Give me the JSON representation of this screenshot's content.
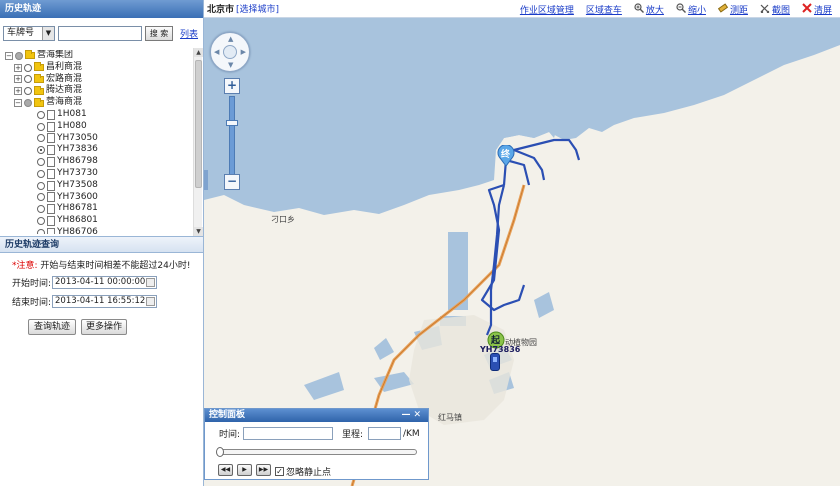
{
  "left_panel": {
    "title": "历史轨迹",
    "search": {
      "type_label": "车牌号",
      "value": "",
      "search_label": "搜 索",
      "list_link": "列表"
    },
    "tree": [
      {
        "label": "营海集团",
        "level": 0,
        "kind": "group"
      },
      {
        "label": "昌利商混",
        "level": 1,
        "kind": "folder"
      },
      {
        "label": "宏路商混",
        "level": 1,
        "kind": "folder"
      },
      {
        "label": "腾达商混",
        "level": 1,
        "kind": "folder"
      },
      {
        "label": "营海商混",
        "level": 1,
        "kind": "folder-open"
      },
      {
        "label": "1H081",
        "level": 2,
        "kind": "vehicle",
        "selected": false
      },
      {
        "label": "1H080",
        "level": 2,
        "kind": "vehicle",
        "selected": false
      },
      {
        "label": "YH73050",
        "level": 2,
        "kind": "vehicle",
        "selected": false
      },
      {
        "label": "YH73836",
        "level": 2,
        "kind": "vehicle",
        "selected": true
      },
      {
        "label": "YH86798",
        "level": 2,
        "kind": "vehicle",
        "selected": false
      },
      {
        "label": "YH73730",
        "level": 2,
        "kind": "vehicle",
        "selected": false
      },
      {
        "label": "YH73508",
        "level": 2,
        "kind": "vehicle",
        "selected": false
      },
      {
        "label": "YH73600",
        "level": 2,
        "kind": "vehicle",
        "selected": false
      },
      {
        "label": "YH86781",
        "level": 2,
        "kind": "vehicle",
        "selected": false
      },
      {
        "label": "YH86801",
        "level": 2,
        "kind": "vehicle",
        "selected": false
      },
      {
        "label": "YH86706",
        "level": 2,
        "kind": "vehicle",
        "selected": false
      }
    ],
    "query": {
      "title": "历史轨迹查询",
      "note_star": "*注意:",
      "note_text": "开始与结束时间相差不能超过24小时!",
      "start_label": "开始时间:",
      "start_value": "2013-04-11 00:00:00",
      "end_label": "结束时间:",
      "end_value": "2013-04-11 16:55:12",
      "query_btn": "查询轨迹",
      "more_btn": "更多操作"
    }
  },
  "map": {
    "city": "北京市",
    "select_city": "[选择城市]",
    "tools": [
      {
        "label": "作业区域管理",
        "icon": ""
      },
      {
        "label": "区域查车",
        "icon": ""
      },
      {
        "label": "放大",
        "icon": "zoom-in-icon"
      },
      {
        "label": "缩小",
        "icon": "zoom-out-icon"
      },
      {
        "label": "测距",
        "icon": "ruler-icon"
      },
      {
        "label": "截图",
        "icon": "screenshot-icon"
      },
      {
        "label": "清屏",
        "icon": "clear-icon"
      }
    ],
    "labels": {
      "place1": "刁口乡",
      "place2": "动植物园",
      "place3": "红马镇"
    },
    "markers": {
      "end": "终",
      "start": "起",
      "vehicle": "YH73836"
    },
    "route_color": "#2b4fb3"
  },
  "control_panel": {
    "title": "控制面板",
    "time_label": "时间:",
    "time_value": "",
    "mileage_label": "里程:",
    "mileage_value": "",
    "mileage_unit": "/KM",
    "progress": 0.0,
    "ignore_stop_label": "忽略静止点",
    "ignore_stop_checked": true
  }
}
